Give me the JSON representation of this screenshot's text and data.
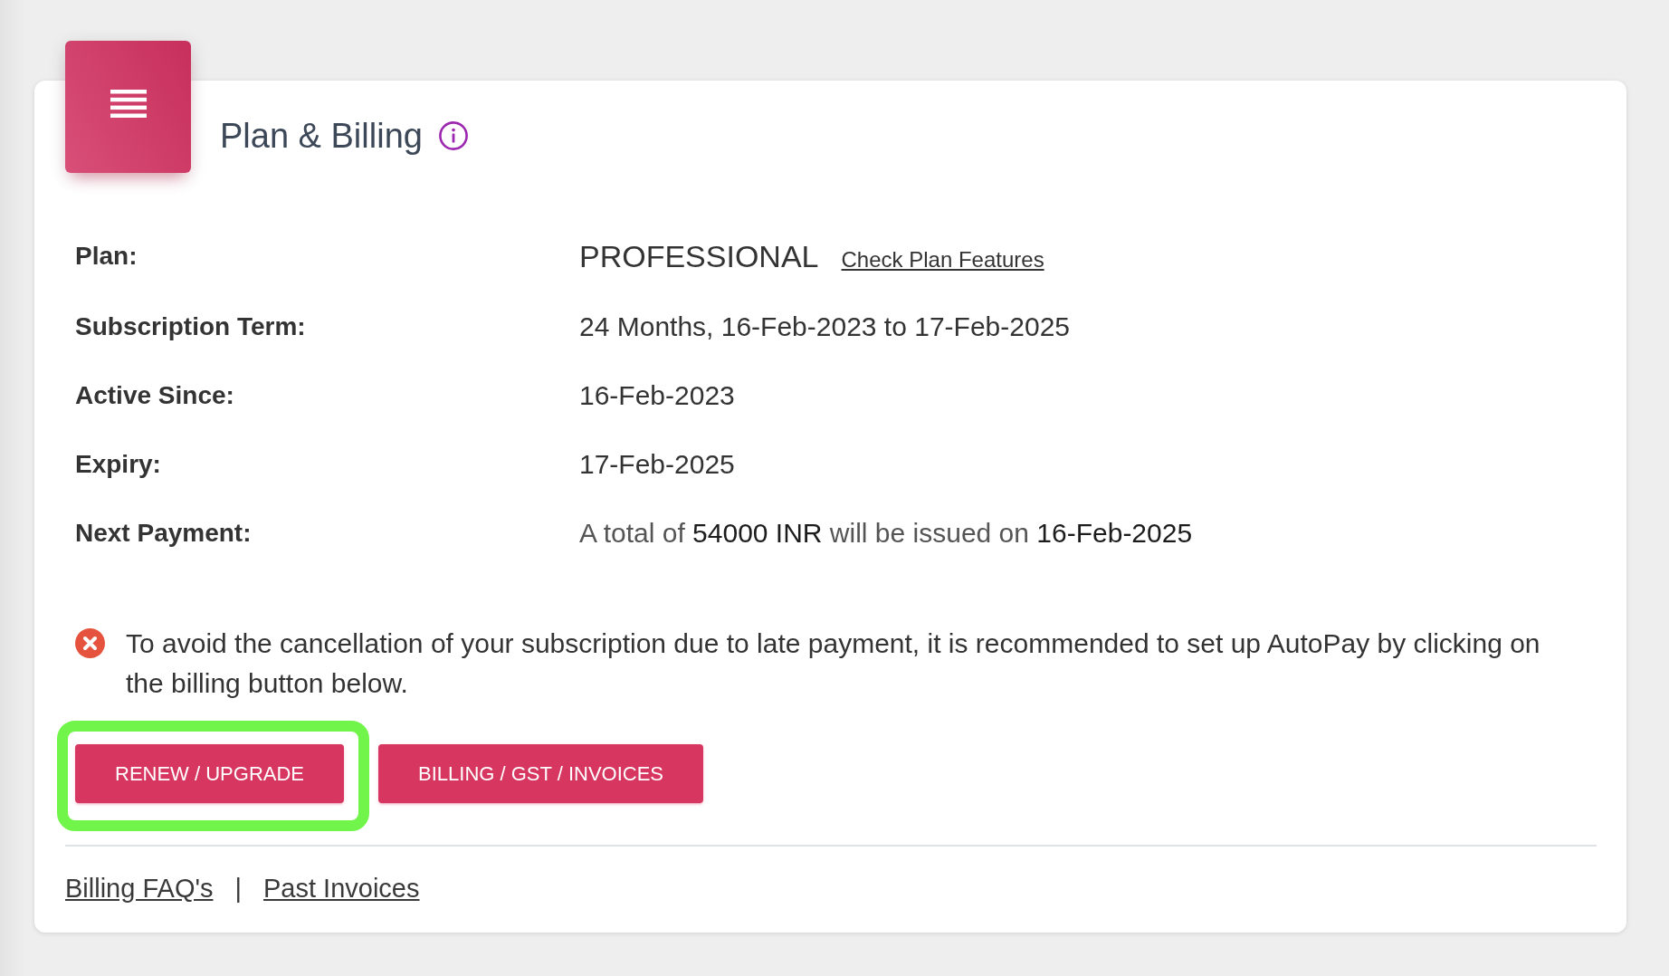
{
  "header": {
    "title": "Plan & Billing"
  },
  "details": [
    {
      "kind": "plan",
      "label": "Plan:",
      "value": "PROFESSIONAL",
      "link": "Check Plan Features"
    },
    {
      "kind": "text",
      "label": "Subscription Term:",
      "value": "24 Months, 16-Feb-2023 to 17-Feb-2025"
    },
    {
      "kind": "text",
      "label": "Active Since:",
      "value": "16-Feb-2023"
    },
    {
      "kind": "text",
      "label": "Expiry:",
      "value": "17-Feb-2025"
    },
    {
      "kind": "mixed",
      "label": "Next Payment:",
      "value": "A total of **54000 INR** will be issued on **16-Feb-2025**"
    }
  ],
  "notice": {
    "kind": "error",
    "text": "To avoid the cancellation of your subscription due to late payment, it is recommended to set up AutoPay by clicking on the billing button below."
  },
  "buttons": [
    {
      "label": "RENEW / UPGRADE",
      "highlighted": true
    },
    {
      "label": "BILLING / GST / INVOICES",
      "highlighted": false
    }
  ],
  "footer": {
    "links": [
      "Billing FAQ's",
      "Past Invoices"
    ],
    "separator": "|"
  }
}
